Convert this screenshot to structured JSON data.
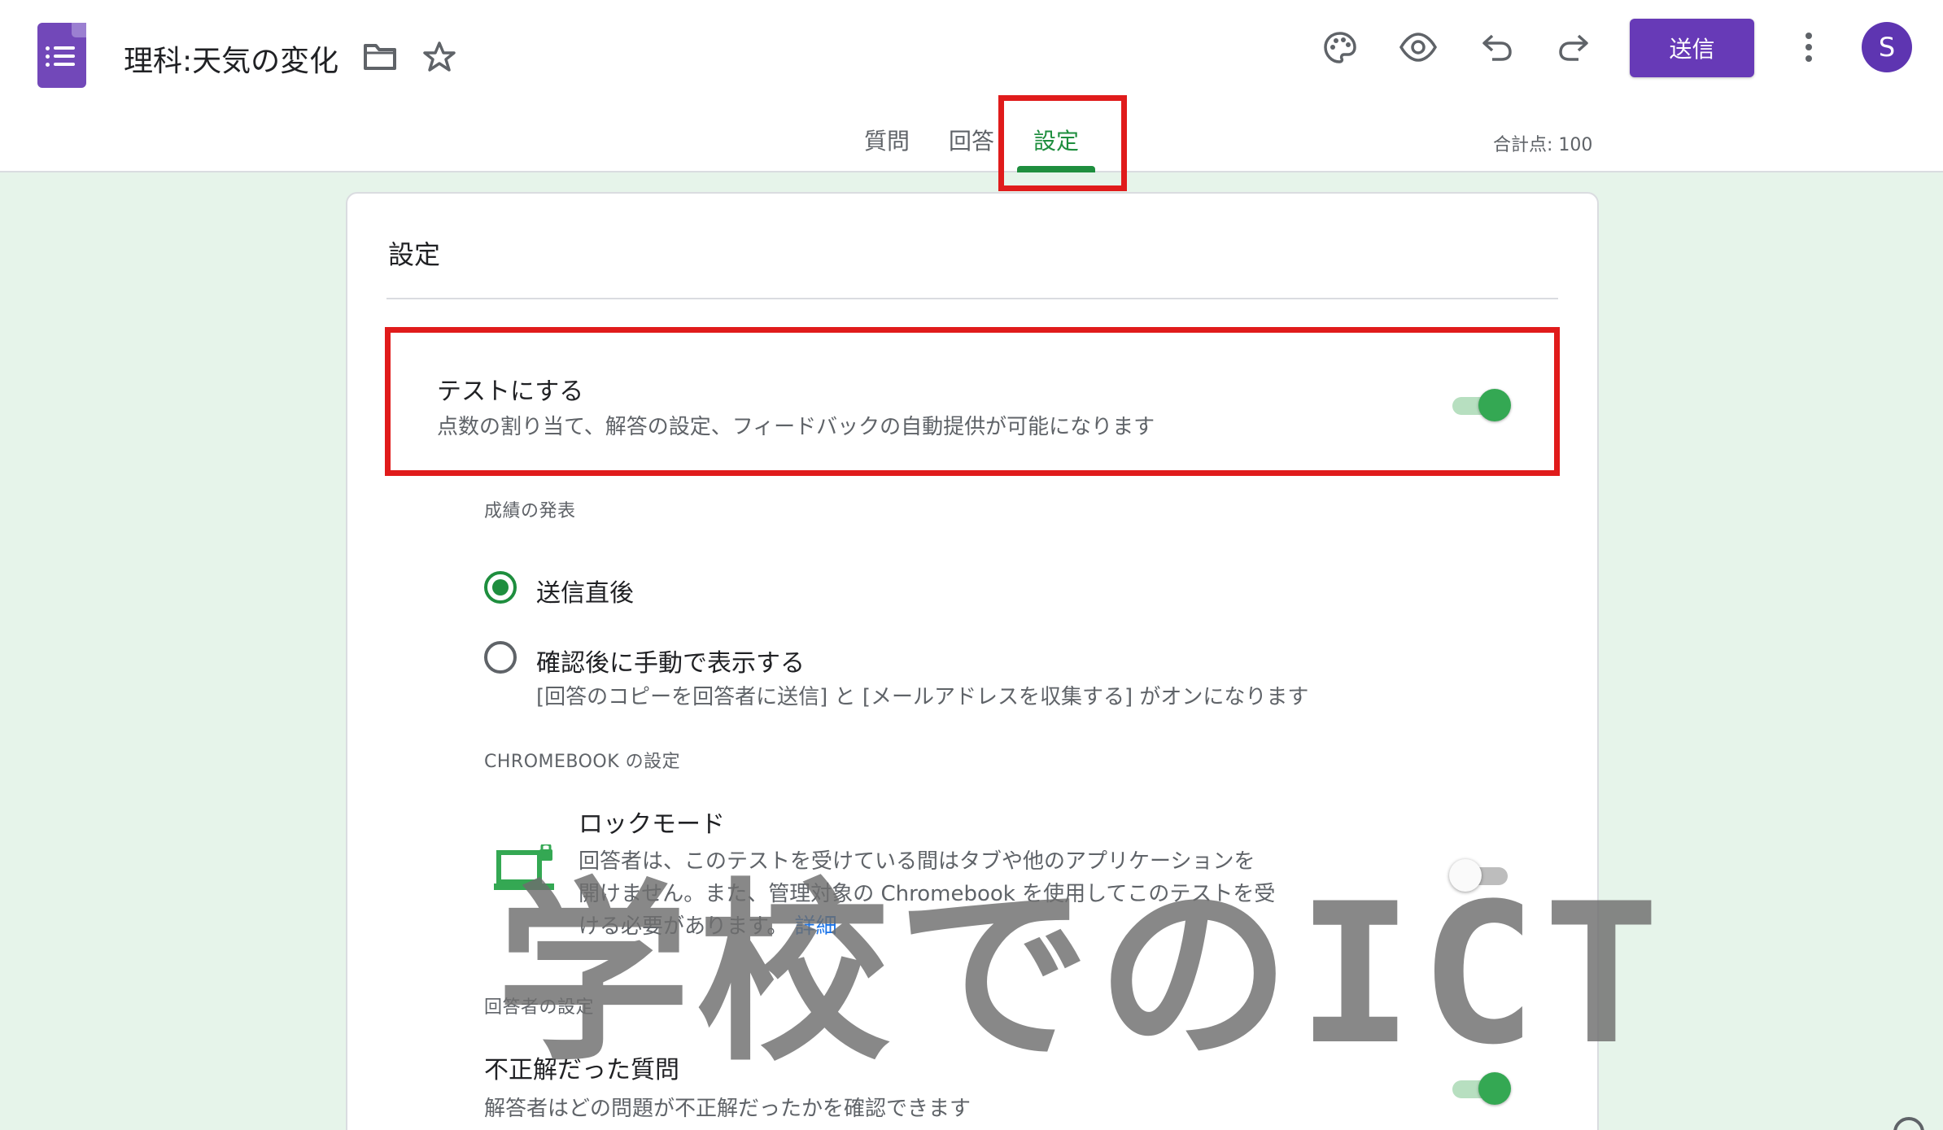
{
  "app": {
    "title": "理科:天気の変化",
    "send_label": "送信",
    "avatar_initial": "S",
    "accent_color": "#673ab7"
  },
  "header_icons": [
    "folder-icon",
    "star-icon",
    "palette-icon",
    "eye-icon",
    "undo-icon",
    "redo-icon",
    "more-vert-icon"
  ],
  "tabs": [
    {
      "label": "質問",
      "active": false
    },
    {
      "label": "回答",
      "active": false
    },
    {
      "label": "設定",
      "active": true
    }
  ],
  "total_points": "合計点: 100",
  "settings": {
    "title": "設定",
    "quiz": {
      "label": "テストにする",
      "description": "点数の割り当て、解答の設定、フィードバックの自動提供が可能になります",
      "enabled": true
    },
    "release": {
      "label": "成績の発表",
      "options": [
        {
          "label": "送信直後",
          "selected": true
        },
        {
          "label": "確認後に手動で表示する",
          "selected": false,
          "note": "[回答のコピーを回答者に送信] と [メールアドレスを収集する] がオンになります"
        }
      ]
    },
    "chromebook": {
      "section_label": "CHROMEBOOK の設定",
      "lock_title": "ロックモード",
      "lock_desc_1": "回答者は、このテストを受けている間はタブや他のアプリケーションを",
      "lock_desc_2": "開けません。また、管理対象の Chromebook を使用してこのテストを受",
      "lock_desc_3": "ける必要があります。",
      "lock_link": "詳細",
      "enabled": false
    },
    "respondent": {
      "section_label": "回答者の設定",
      "incorrect_title": "不正解だった質問",
      "incorrect_desc": "解答者はどの問題が不正解だったかを確認できます",
      "enabled": true
    }
  },
  "watermark": "学校でのICT"
}
